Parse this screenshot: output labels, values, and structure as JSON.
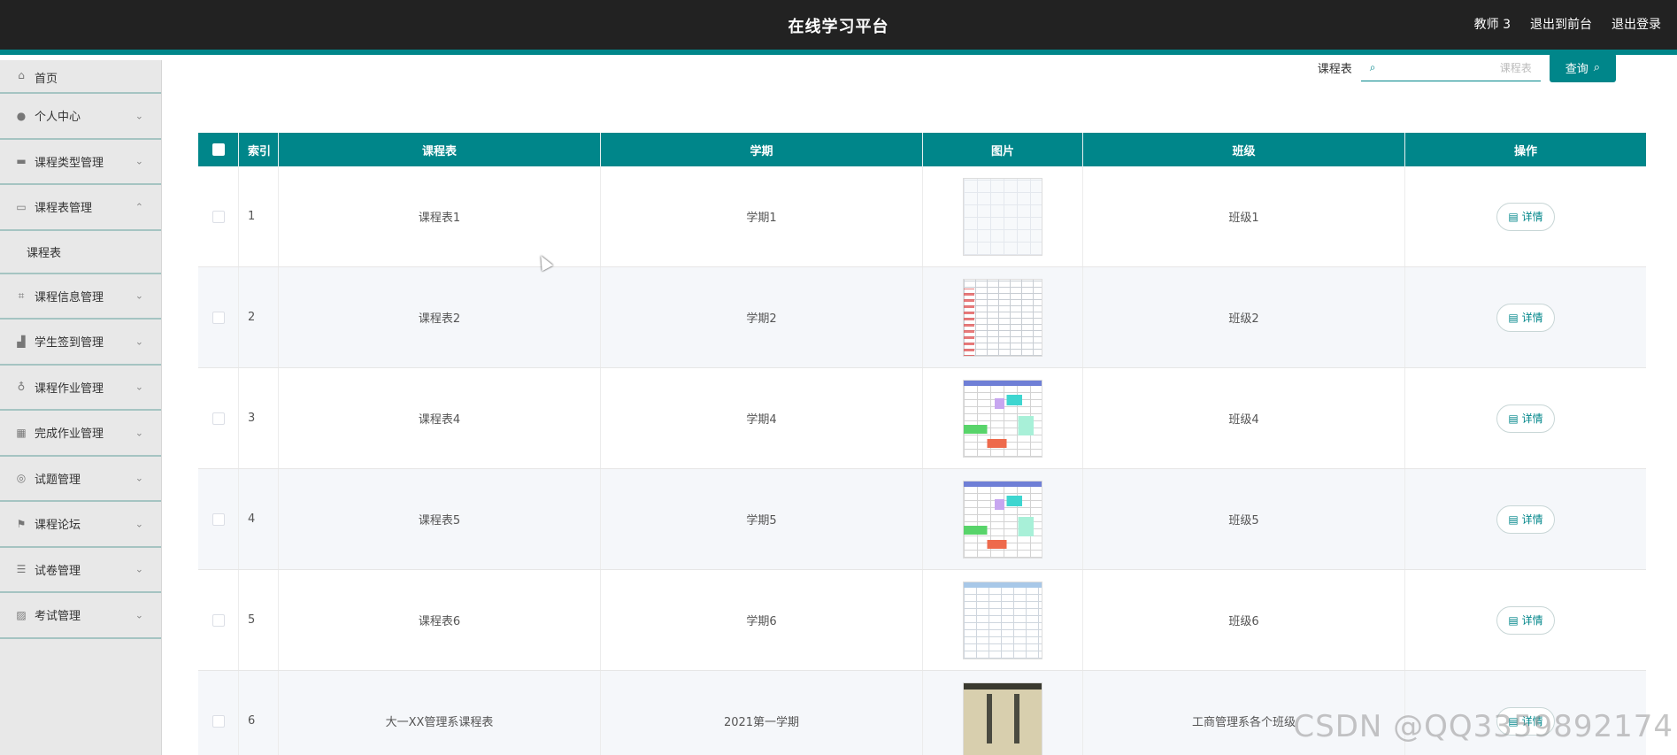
{
  "header": {
    "title": "在线学习平台",
    "user": "教师 3",
    "to_front": "退出到前台",
    "logout": "退出登录"
  },
  "sidebar": {
    "items": [
      {
        "label": "首页",
        "icon": "home-icon"
      },
      {
        "label": "个人中心",
        "icon": "user-icon"
      },
      {
        "label": "课程类型管理",
        "icon": "ticket-icon"
      },
      {
        "label": "课程表管理",
        "icon": "briefcase-icon"
      },
      {
        "label": "课程信息管理",
        "icon": "crop-icon"
      },
      {
        "label": "学生签到管理",
        "icon": "stamp-icon"
      },
      {
        "label": "课程作业管理",
        "icon": "mic-icon"
      },
      {
        "label": "完成作业管理",
        "icon": "grid-icon"
      },
      {
        "label": "试题管理",
        "icon": "globe-icon"
      },
      {
        "label": "课程论坛",
        "icon": "flag-icon"
      },
      {
        "label": "试卷管理",
        "icon": "sliders-icon"
      },
      {
        "label": "考试管理",
        "icon": "chart-icon"
      }
    ],
    "submenu": "课程表"
  },
  "search": {
    "label": "课程表",
    "placeholder": "课程表",
    "button": "查询"
  },
  "table": {
    "headers": [
      "索引",
      "课程表",
      "学期",
      "图片",
      "班级",
      "操作"
    ],
    "detail_label": "详情",
    "rows": [
      {
        "index": "1",
        "name": "课程表1",
        "term": "学期1",
        "class": "班级1"
      },
      {
        "index": "2",
        "name": "课程表2",
        "term": "学期2",
        "class": "班级2"
      },
      {
        "index": "3",
        "name": "课程表4",
        "term": "学期4",
        "class": "班级4"
      },
      {
        "index": "4",
        "name": "课程表5",
        "term": "学期5",
        "class": "班级5"
      },
      {
        "index": "5",
        "name": "课程表6",
        "term": "学期6",
        "class": "班级6"
      },
      {
        "index": "6",
        "name": "大一XX管理系课程表",
        "term": "2021第一学期",
        "class": "工商管理系各个班级"
      }
    ]
  },
  "watermark": "CSDN @QQ3359892174",
  "colors": {
    "accent": "#00868a",
    "header_bg": "#222222"
  }
}
